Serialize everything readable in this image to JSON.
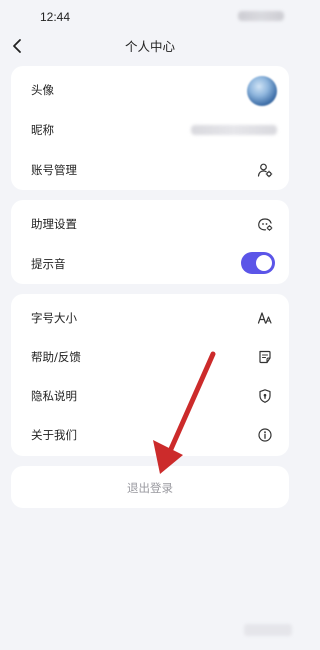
{
  "status_bar": {
    "time": "12:44"
  },
  "header": {
    "title": "个人中心",
    "back_icon": "chevron-left-icon"
  },
  "account_section": {
    "avatar_label": "头像",
    "nickname_label": "昵称",
    "account_manage_label": "账号管理",
    "account_manage_icon": "user-settings-icon"
  },
  "assistant_section": {
    "assistant_settings_label": "助理设置",
    "assistant_settings_icon": "bot-settings-icon",
    "notification_sound_label": "提示音",
    "notification_sound_enabled": true,
    "toggle_color": "#5b55e8"
  },
  "misc_section": {
    "items": [
      {
        "label": "字号大小",
        "icon": "font-size-icon"
      },
      {
        "label": "帮助/反馈",
        "icon": "feedback-icon"
      },
      {
        "label": "隐私说明",
        "icon": "shield-icon"
      },
      {
        "label": "关于我们",
        "icon": "info-icon"
      }
    ]
  },
  "logout": {
    "label": "退出登录"
  },
  "annotation": {
    "arrow_color": "#cc2b2b",
    "arrow_icon": "red-arrow-annotation"
  }
}
